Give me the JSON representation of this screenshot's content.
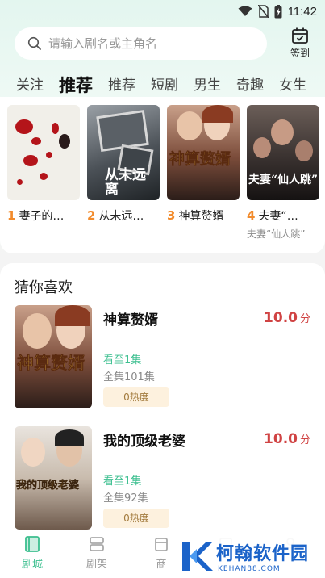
{
  "status": {
    "time": "11:42"
  },
  "search": {
    "placeholder": "请输入剧名或主角名"
  },
  "checkin": {
    "label": "签到"
  },
  "tabs": [
    "关注",
    "推荐",
    "推荐",
    "短剧",
    "男生",
    "奇趣",
    "女生"
  ],
  "active_tab_index": 1,
  "top_ranking": [
    {
      "rank": "1",
      "title": "妻子的…",
      "subtitle": "",
      "poster_text": ""
    },
    {
      "rank": "2",
      "title": "从未远…",
      "subtitle": "",
      "poster_text": "从未远离"
    },
    {
      "rank": "3",
      "title": "神算赘婿",
      "subtitle": "",
      "poster_text": "神算赘婿"
    },
    {
      "rank": "4",
      "title": "夫妻“…",
      "subtitle": "夫妻“仙人跳”",
      "poster_text": "夫妻“仙人跳”"
    }
  ],
  "guess": {
    "title": "猜你喜欢",
    "items": [
      {
        "title": "神算赘婿",
        "score": "10.0",
        "score_unit": "分",
        "progress": "看至1集",
        "total": "全集101集",
        "heat": "0热度",
        "poster_text": "神算赘婿"
      },
      {
        "title": "我的顶级老婆",
        "score": "10.0",
        "score_unit": "分",
        "progress": "看至1集",
        "total": "全集92集",
        "heat": "0热度",
        "poster_text": "我的顶级老婆"
      }
    ]
  },
  "bottom_nav": [
    {
      "label": "剧城",
      "icon": "drama-city-icon",
      "active": true
    },
    {
      "label": "剧架",
      "icon": "shelf-icon",
      "active": false
    },
    {
      "label": "商",
      "icon": "store-icon",
      "active": false
    },
    {
      "label": "",
      "icon": "tab-icon",
      "active": false
    },
    {
      "label": "",
      "icon": "profile-icon",
      "active": false
    }
  ],
  "watermark": {
    "main": "柯翰软件园",
    "sub": "KEHAN88.COM",
    "logo_letter": "K"
  },
  "colors": {
    "accent": "#3cbf8f",
    "rank": "#f28b2c",
    "score": "#d04343",
    "watermark": "#1b63c9"
  }
}
